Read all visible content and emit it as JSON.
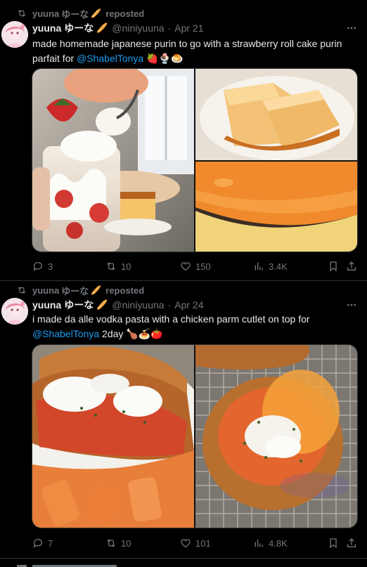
{
  "tweets": [
    {
      "repost_by": "yuuna",
      "repost_suffix": "reposted",
      "name": "yuuna",
      "name_glyphs": "ゆーな",
      "handle": "@niniyuuna",
      "dot": "·",
      "date": "Apr 21",
      "text_before": "made homemade japanese purin to go with a strawberry roll cake purin parfait for ",
      "mention": "@ShabelTonya",
      "text_after": " 🍓🍨🍮",
      "replies": "3",
      "reposts": "10",
      "likes": "150",
      "views": "3.4K"
    },
    {
      "repost_by": "yuuna",
      "repost_suffix": "reposted",
      "name": "yuuna",
      "name_glyphs": "ゆーな",
      "handle": "@niniyuuna",
      "dot": "·",
      "date": "Apr 24",
      "text_before": "i made da alle vodka pasta with a chicken parm cutlet on top for ",
      "mention": "@ShabelTonya",
      "text_after": " 2day 🍗🍝🍅",
      "replies": "7",
      "reposts": "10",
      "likes": "101",
      "views": "4.8K"
    }
  ],
  "icons": {
    "repost": "repost-icon",
    "reply": "reply-icon",
    "like": "heart-icon",
    "views": "views-icon",
    "bookmark": "bookmark-icon",
    "share": "share-icon",
    "more": "more-icon",
    "name_badge": "baguette-icon"
  },
  "colors": {
    "background": "#000000",
    "text": "#e7e9ea",
    "muted": "#71767b",
    "accent": "#1d9bf0",
    "divider": "#2f3336"
  }
}
